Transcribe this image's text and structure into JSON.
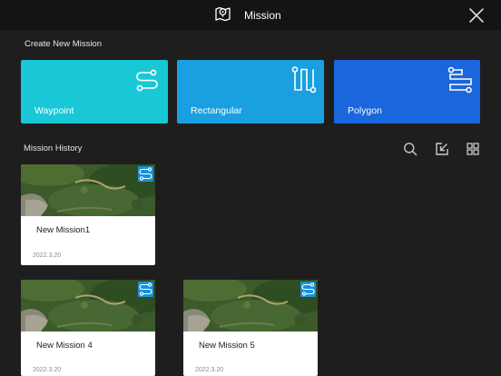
{
  "header": {
    "title": "Mission"
  },
  "create": {
    "section_label": "Create New Mission",
    "cards": [
      {
        "label": "Waypoint",
        "color": "#19c7d6"
      },
      {
        "label": "Rectangular",
        "color": "#1a9fe0"
      },
      {
        "label": "Polygon",
        "color": "#1a66dc"
      }
    ]
  },
  "history": {
    "section_label": "Mission History",
    "missions": [
      {
        "name": "New Mission1",
        "date": "2022.3.20"
      },
      {
        "name": "New Mission 4",
        "date": "2022.3.20"
      },
      {
        "name": "New Mission 5",
        "date": "2022.3.20"
      }
    ]
  },
  "colors": {
    "topbar": "#141414",
    "background": "#1e1e1e",
    "badge": "#1b90d8"
  },
  "icons": [
    "map-pin-icon",
    "close-icon",
    "waypoint-icon",
    "rectangular-icon",
    "polygon-icon",
    "search-icon",
    "import-icon",
    "grid-view-icon",
    "waypoint-badge-icon"
  ]
}
